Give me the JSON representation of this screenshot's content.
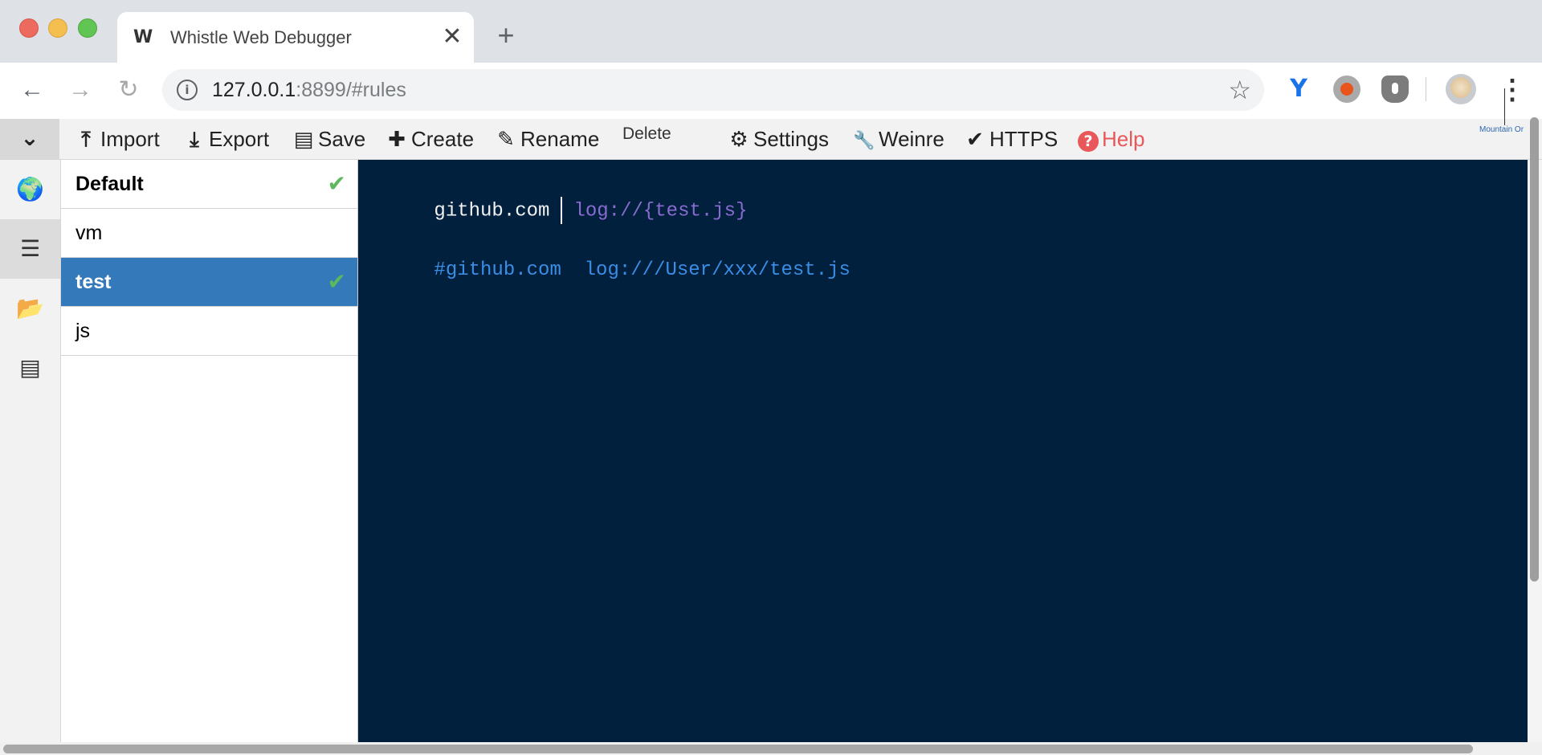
{
  "browser": {
    "tab_title": "Whistle Web Debugger",
    "tab_logo": "W",
    "tab_close": "✕",
    "new_tab": "+",
    "url_host": "127.0.0.1",
    "url_rest": ":8899/#rules",
    "icons": [
      "back-icon",
      "forward-icon",
      "reload-icon",
      "info-icon",
      "star-icon",
      "extension-icon",
      "avatar",
      "menu-icon"
    ]
  },
  "menu": {
    "toggle": "⌄",
    "items": [
      {
        "icon": "⤒",
        "label": "Import"
      },
      {
        "icon": "⤓",
        "label": "Export"
      },
      {
        "icon": "▤",
        "label": "Save"
      },
      {
        "icon": "✚",
        "label": "Create"
      },
      {
        "icon": "✎",
        "label": "Rename"
      },
      {
        "icon": "",
        "label": "Delete"
      },
      {
        "icon": "⚙",
        "label": "Settings"
      },
      {
        "icon": "🔧",
        "label": "Weinre"
      },
      {
        "icon": "✔",
        "label": "HTTPS"
      },
      {
        "icon": "?",
        "label": "Help"
      }
    ],
    "tooltip": "Mountain Or"
  },
  "sidebar": {
    "items": [
      {
        "icon": "network-globe-icon",
        "active": false
      },
      {
        "icon": "rules-list-icon",
        "active": true
      },
      {
        "icon": "values-folder-icon",
        "active": false
      },
      {
        "icon": "plugins-icon",
        "active": false
      }
    ]
  },
  "rules": {
    "items": [
      {
        "label": "Default",
        "checked": true,
        "selected": false
      },
      {
        "label": "vm",
        "checked": false,
        "selected": false
      },
      {
        "label": "test",
        "checked": true,
        "selected": true
      },
      {
        "label": "js",
        "checked": false,
        "selected": false
      }
    ]
  },
  "editor": {
    "line1_host": "github.com",
    "line1_op": "log://{test.js}",
    "line3_comment": "#github.com  log:///User/xxx/test.js"
  },
  "colors": {
    "editor_bg": "#00203d",
    "selected_rule": "#3479ba",
    "check": "#5cb85c",
    "help": "#e8585a",
    "operator": "#8a6bd1",
    "comment": "#3a8ee6"
  }
}
